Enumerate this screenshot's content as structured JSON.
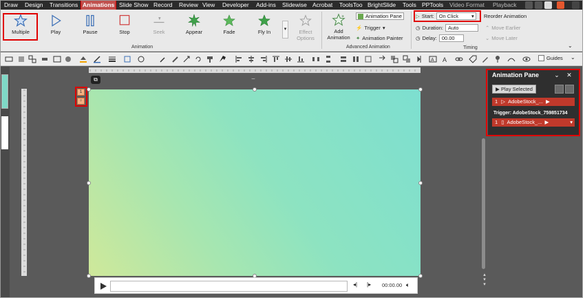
{
  "menu": {
    "tabs": [
      "Draw",
      "Design",
      "Transitions",
      "Animations",
      "Slide Show",
      "Record",
      "Review",
      "View",
      "Developer",
      "Add-ins",
      "Slidewise",
      "Acrobat",
      "ToolsToo",
      "BrightSlide",
      "Tools",
      "PPTools",
      "Video Format",
      "Playback"
    ],
    "active": "Animations"
  },
  "ribbon": {
    "effects": [
      {
        "label": "Multiple",
        "icon": "star-outline-icon"
      },
      {
        "label": "Play",
        "icon": "play-triangle-icon"
      },
      {
        "label": "Pause",
        "icon": "pause-icon"
      },
      {
        "label": "Stop",
        "icon": "stop-square-icon"
      },
      {
        "label": "Seek",
        "icon": "seek-icon"
      },
      {
        "label": "Appear",
        "icon": "appear-star-icon"
      },
      {
        "label": "Fade",
        "icon": "fade-star-icon"
      },
      {
        "label": "Fly In",
        "icon": "fly-in-star-icon"
      }
    ],
    "effect_options": "Effect Options",
    "animation_group_label": "Animation",
    "add_animation": "Add Animation",
    "animation_pane": "Animation Pane",
    "trigger": "Trigger",
    "animation_painter": "Animation Painter",
    "advanced_group_label": "Advanced Animation",
    "start_label": "Start:",
    "start_value": "On Click",
    "duration_label": "Duration:",
    "duration_value": "Auto",
    "delay_label": "Delay:",
    "delay_value": "00.00",
    "timing_group_label": "Timing",
    "reorder_title": "Reorder Animation",
    "move_earlier": "Move Earlier",
    "move_later": "Move Later"
  },
  "toolbar2": {
    "guides_label": "Guides"
  },
  "slide": {
    "badges": [
      "1",
      "♀"
    ]
  },
  "media": {
    "time": "00:00.00"
  },
  "animation_pane": {
    "title": "Animation Pane",
    "play_selected": "Play Selected",
    "items": [
      {
        "num": "1",
        "name": "AdobeStock_..."
      }
    ],
    "trigger_label": "Trigger: AdobeStock_759851734",
    "trigger_items": [
      {
        "num": "1",
        "name": "AdobeStock_..."
      }
    ]
  },
  "colors": {
    "highlight": "#e00000",
    "anim_row": "#c0392b",
    "badge": "#f4b183"
  }
}
